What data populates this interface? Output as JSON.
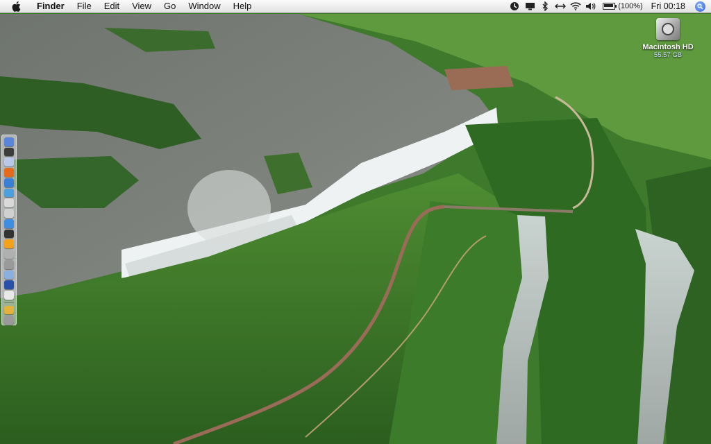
{
  "menubar": {
    "apple_icon": "apple-logo-icon",
    "items": [
      {
        "label": "Finder",
        "bold": true
      },
      {
        "label": "File"
      },
      {
        "label": "Edit"
      },
      {
        "label": "View"
      },
      {
        "label": "Go"
      },
      {
        "label": "Window"
      },
      {
        "label": "Help"
      }
    ],
    "status": {
      "icons": [
        "timemachine-icon",
        "display-icon",
        "bluetooth-icon",
        "sync-icon",
        "wifi-icon",
        "volume-icon"
      ],
      "battery_text": "(100%)",
      "battery_level": 1.0,
      "clock": "Fri 00:18",
      "spotlight_icon": "spotlight-icon"
    }
  },
  "desktop": {
    "drive": {
      "name": "Macintosh HD",
      "size": "55.57 GB"
    }
  },
  "dock": {
    "icons": [
      "finder-icon",
      "system-preferences-icon",
      "mail-icon",
      "firefox-icon",
      "itunes-icon",
      "app-icon",
      "preview-icon",
      "calendar-icon",
      "safari-icon",
      "terminal-icon",
      "vlc-icon",
      "app-icon",
      "app-icon",
      "app-icon",
      "app-icon",
      "app-icon",
      "app-icon",
      "trash-icon"
    ],
    "colors": [
      "#5a86d9",
      "#3c3c3c",
      "#b9c8e8",
      "#e46a1e",
      "#3b7fd6",
      "#4da0e0",
      "#d9d9d9",
      "#d0d0d0",
      "#3f8de0",
      "#333333",
      "#f2a31b",
      "#b0b0b0",
      "#9a9a9a",
      "#8bb0e0",
      "#2850a8",
      "#e8e8e8",
      "#e2b23a",
      "#9a9a9a"
    ]
  }
}
